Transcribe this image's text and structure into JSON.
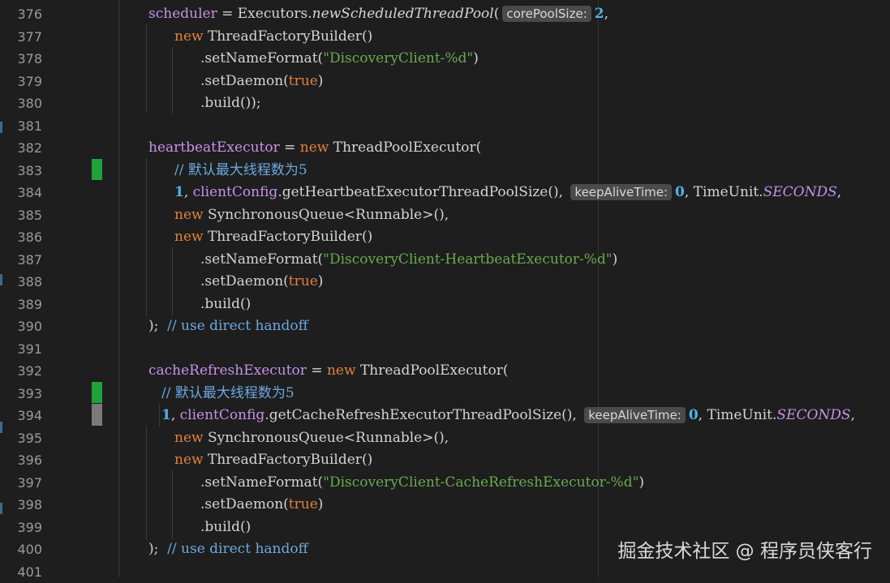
{
  "line_numbers": [
    "376",
    "377",
    "378",
    "379",
    "380",
    "381",
    "382",
    "383",
    "384",
    "385",
    "386",
    "387",
    "388",
    "389",
    "390",
    "391",
    "392",
    "393",
    "394",
    "395",
    "396",
    "397",
    "398",
    "399",
    "400",
    "401"
  ],
  "code": {
    "l376": {
      "a": "scheduler",
      "b": " = Executors.",
      "c": "newScheduledThreadPool",
      "d": "(",
      "hint": "corePoolSize:",
      "e": "2",
      ",": ","
    },
    "l377": {
      "a": "new",
      "b": " ThreadFactoryBuilder()"
    },
    "l378": {
      "a": ".setNameFormat(",
      "b": "\"DiscoveryClient-%d\"",
      "c": ")"
    },
    "l379": {
      "a": ".setDaemon(",
      "b": "true",
      "c": ")"
    },
    "l380": {
      "a": ".build());"
    },
    "l382": {
      "a": "heartbeatExecutor",
      "b": " = ",
      "c": "new",
      "d": " ThreadPoolExecutor("
    },
    "l383": {
      "a": "// 默认最大线程数为5"
    },
    "l384": {
      "a": "1",
      ",": ", ",
      "b": "clientConfig",
      ".": ".getHeartbeatExecutorThreadPoolSize(), ",
      "hint": "keepAliveTime:",
      "c": "0",
      "d": ", TimeUnit.",
      "e": "SECONDS",
      ",2": ","
    },
    "l385": {
      "a": "new",
      "b": " SynchronousQueue<Runnable>(),"
    },
    "l386": {
      "a": "new",
      "b": " ThreadFactoryBuilder()"
    },
    "l387": {
      "a": ".setNameFormat(",
      "b": "\"DiscoveryClient-HeartbeatExecutor-%d\"",
      "c": ")"
    },
    "l388": {
      "a": ".setDaemon(",
      "b": "true",
      "c": ")"
    },
    "l389": {
      "a": ".build()"
    },
    "l390": {
      "a": ");",
      "b": "  // use direct handoff"
    },
    "l392": {
      "a": "cacheRefreshExecutor",
      "b": " = ",
      "c": "new",
      "d": " ThreadPoolExecutor("
    },
    "l393": {
      "a": "// 默认最大线程数为5"
    },
    "l394": {
      "a": "1",
      ",": ", ",
      "b": "clientConfig",
      ".": ".getCacheRefreshExecutorThreadPoolSize(), ",
      "hint": "keepAliveTime:",
      "c": "0",
      "d": ", TimeUnit.",
      "e": "SECONDS",
      ",2": ","
    },
    "l395": {
      "a": "new",
      "b": " SynchronousQueue<Runnable>(),"
    },
    "l396": {
      "a": "new",
      "b": " ThreadFactoryBuilder()"
    },
    "l397": {
      "a": ".setNameFormat(",
      "b": "\"DiscoveryClient-CacheRefreshExecutor-%d\"",
      "c": ")"
    },
    "l398": {
      "a": ".setDaemon(",
      "b": "true",
      "c": ")"
    },
    "l399": {
      "a": ".build()"
    },
    "l400": {
      "a": ");",
      "b": "  // use direct handoff"
    }
  },
  "watermark": "掘金技术社区 @ 程序员侠客行",
  "colors": {
    "added_marker": "#1fa23a",
    "modified_marker": "#7a7a7a",
    "background": "#1e1e1e"
  }
}
